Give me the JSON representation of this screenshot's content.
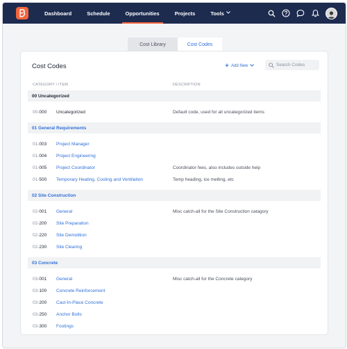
{
  "nav": {
    "items": [
      {
        "label": "Dashboard"
      },
      {
        "label": "Schedule"
      },
      {
        "label": "Opportunities"
      },
      {
        "label": "Projects"
      },
      {
        "label": "Tools"
      }
    ],
    "active_index": 2,
    "brand_color": "#f4643d",
    "bar_color": "#1d2b4f"
  },
  "tabs": [
    {
      "label": "Cost Library"
    },
    {
      "label": "Cost Codes"
    }
  ],
  "card": {
    "title": "Cost Codes",
    "add_new_label": "Add New",
    "search_placeholder": "Search Codes",
    "col_category": "CATEGORY / ITEM",
    "col_description": "DESCRIPTION"
  },
  "groups": [
    {
      "label": "00 Uncategorized",
      "items": [
        {
          "prefix": "00-",
          "code": "000",
          "name": "Uncategorized",
          "description": "Default code, used for all uncategorized items"
        }
      ]
    },
    {
      "label": "01 General Requirements",
      "items": [
        {
          "prefix": "01-",
          "code": "003",
          "name": "Project Manager",
          "description": ""
        },
        {
          "prefix": "01-",
          "code": "004",
          "name": "Project Engineering",
          "description": ""
        },
        {
          "prefix": "01-",
          "code": "005",
          "name": "Project Coordinator",
          "description": "Coordinator fees, also includes outside help"
        },
        {
          "prefix": "01-",
          "code": "500",
          "name": "Temporary Heating, Cooling and Ventilation",
          "description": "Temp heading, ice melting, etc"
        }
      ]
    },
    {
      "label": "02 Site Construction",
      "items": [
        {
          "prefix": "02-",
          "code": "001",
          "name": "General",
          "description": "Misc catch-all for the Site Construction catagory"
        },
        {
          "prefix": "02-",
          "code": "200",
          "name": "Site Preparation",
          "description": ""
        },
        {
          "prefix": "02-",
          "code": "220",
          "name": "Site Demolition",
          "description": ""
        },
        {
          "prefix": "02-",
          "code": "230",
          "name": "Site Clearing",
          "description": ""
        }
      ]
    },
    {
      "label": "03 Concrete",
      "items": [
        {
          "prefix": "03-",
          "code": "001",
          "name": "General",
          "description": "Misc catch-all for the Concrete category"
        },
        {
          "prefix": "03-",
          "code": "100",
          "name": "Concrete Reinforcement",
          "description": ""
        },
        {
          "prefix": "03-",
          "code": "200",
          "name": "Cast-In-Place Concrete",
          "description": ""
        },
        {
          "prefix": "03-",
          "code": "250",
          "name": "Anchor Bolts",
          "description": ""
        },
        {
          "prefix": "03-",
          "code": "300",
          "name": "Footings",
          "description": ""
        }
      ]
    }
  ],
  "icons": [
    "logo-icon",
    "search-icon",
    "help-icon",
    "chat-icon",
    "bell-icon",
    "avatar",
    "plus-icon",
    "chevron-down-icon"
  ]
}
